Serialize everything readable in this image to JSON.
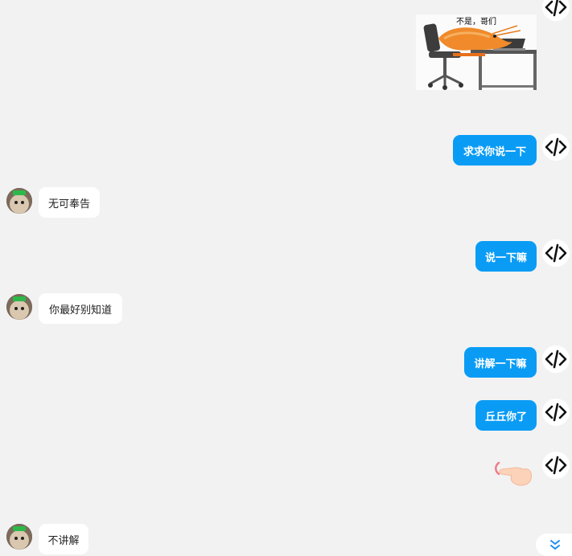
{
  "messages": [
    {
      "side": "out",
      "kind": "image",
      "caption": "不是，哥们"
    },
    {
      "side": "out",
      "kind": "text",
      "text": "求求你说一下"
    },
    {
      "side": "in",
      "kind": "text",
      "text": "无可奉告"
    },
    {
      "side": "out",
      "kind": "text",
      "text": "说一下嘛"
    },
    {
      "side": "in",
      "kind": "text",
      "text": "你最好别知道"
    },
    {
      "side": "out",
      "kind": "text",
      "text": "讲解一下嘛"
    },
    {
      "side": "out",
      "kind": "text",
      "text": "丘丘你了"
    },
    {
      "side": "out",
      "kind": "emoji",
      "icon": "pointing-hand-emoji"
    },
    {
      "side": "in",
      "kind": "text",
      "text": "不讲解"
    }
  ],
  "colors": {
    "background": "#f2f2f2",
    "outgoing_bubble": "#0a9cf5",
    "incoming_bubble": "#ffffff"
  },
  "icons": {
    "user_avatar": "code-icon",
    "bot_avatar": "dog-avatar",
    "scroll": "double-chevron-down-icon"
  }
}
